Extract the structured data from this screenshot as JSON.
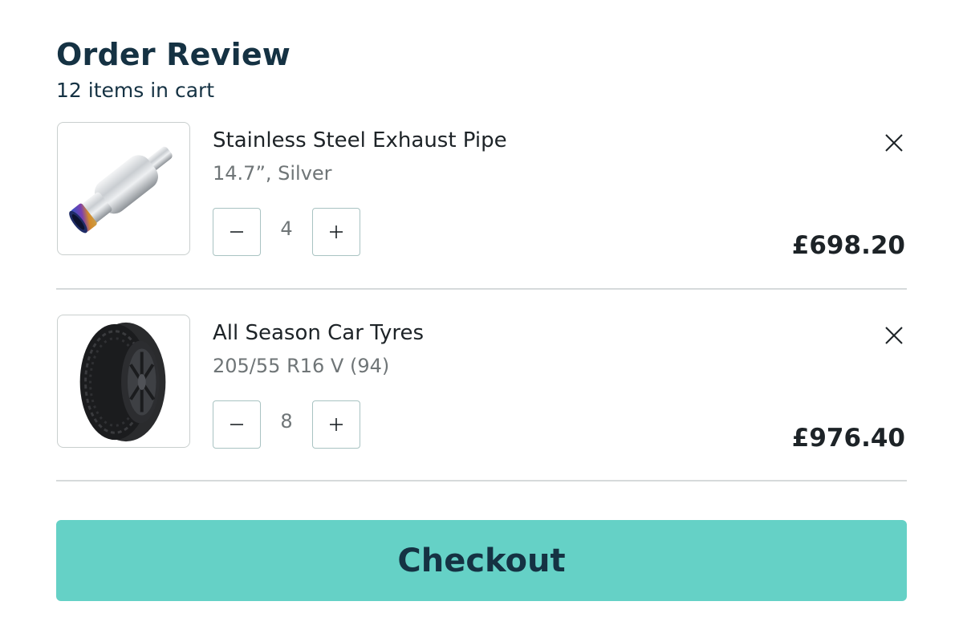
{
  "header": {
    "title": "Order Review",
    "subtitle": "12 items in cart"
  },
  "items": [
    {
      "name": "Stainless Steel Exhaust Pipe",
      "variant": "14.7”, Silver",
      "quantity": "4",
      "price": "£698.20",
      "image": "exhaust-pipe-image"
    },
    {
      "name": "All Season Car Tyres",
      "variant": "205/55 R16 V (94)",
      "quantity": "8",
      "price": "£976.40",
      "image": "car-tyre-image"
    }
  ],
  "checkout": {
    "label": "Checkout"
  },
  "icons": {
    "remove": "close-icon",
    "decrease": "minus-icon",
    "increase": "plus-icon"
  },
  "colors": {
    "accent": "#65d1c6",
    "heading": "#153243",
    "text": "#1d2327",
    "muted": "#6f7577",
    "border": "#a9c3c2"
  }
}
